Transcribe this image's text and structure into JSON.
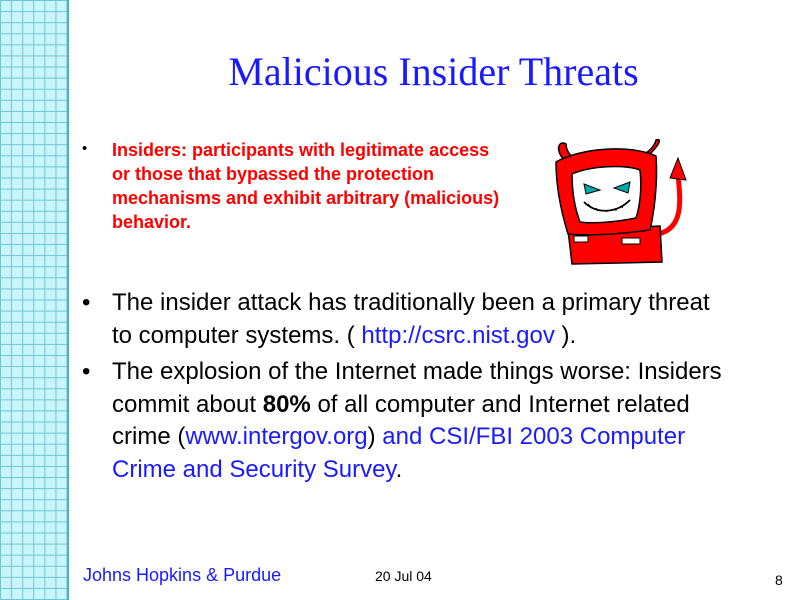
{
  "slide": {
    "title": "Malicious Insider Threats",
    "bullet1": {
      "marker": "•",
      "text": "Insiders: participants with legitimate access or those that bypassed the protection mechanisms and exhibit arbitrary (malicious) behavior."
    },
    "bullet2": {
      "marker": "•",
      "text_a": "The insider attack has traditionally been a primary threat to computer systems. ( ",
      "link": "http://csrc.nist.gov",
      "text_b": " )."
    },
    "bullet3": {
      "marker": "•",
      "text_a": "The explosion of the Internet made things worse: Insiders commit about ",
      "bold": "80%",
      "text_b": " of all computer and Internet related crime (",
      "link1": "www.intergov.org",
      "text_c": ")",
      "link2": " and CSI/FBI 2003 Computer Crime and Security Survey",
      "text_d": "."
    },
    "image": "devil-computer-icon",
    "colors": {
      "title": "#1a1aff",
      "emphasis": "#ff0000",
      "grid": "#c8f4fb"
    }
  },
  "footer": {
    "org": "Johns Hopkins & Purdue",
    "date": "20 Jul 04",
    "page": "8"
  }
}
